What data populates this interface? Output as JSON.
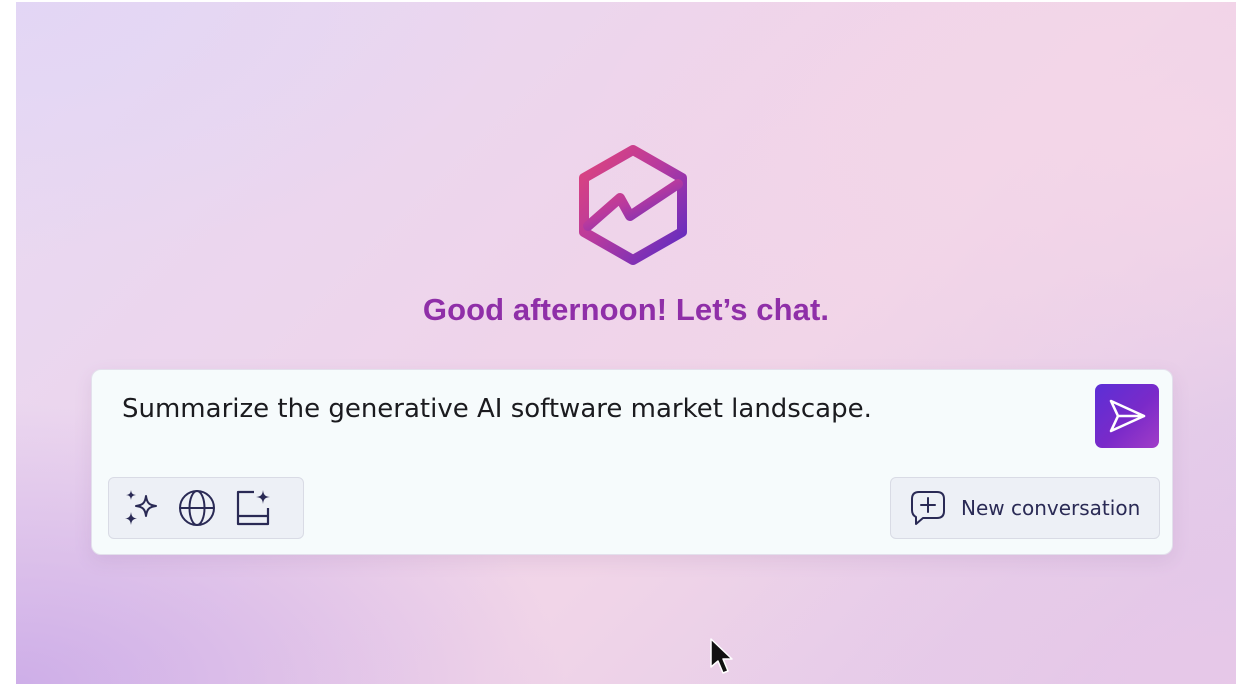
{
  "greeting": "Good afternoon! Let’s chat.",
  "prompt": {
    "value": "Summarize the generative AI software market landscape."
  },
  "tools": [
    {
      "icon": "sparkles-icon"
    },
    {
      "icon": "globe-icon"
    },
    {
      "icon": "document-sparkle-icon"
    }
  ],
  "new_conversation": {
    "label": "New conversation",
    "icon": "chat-add-icon"
  },
  "send": {
    "icon": "send-icon"
  },
  "colors": {
    "accent": "#8f2fa8",
    "send_gradient_start": "#5b2fd6",
    "send_gradient_end": "#a13dc8",
    "icon_ink": "#2a2a55"
  }
}
